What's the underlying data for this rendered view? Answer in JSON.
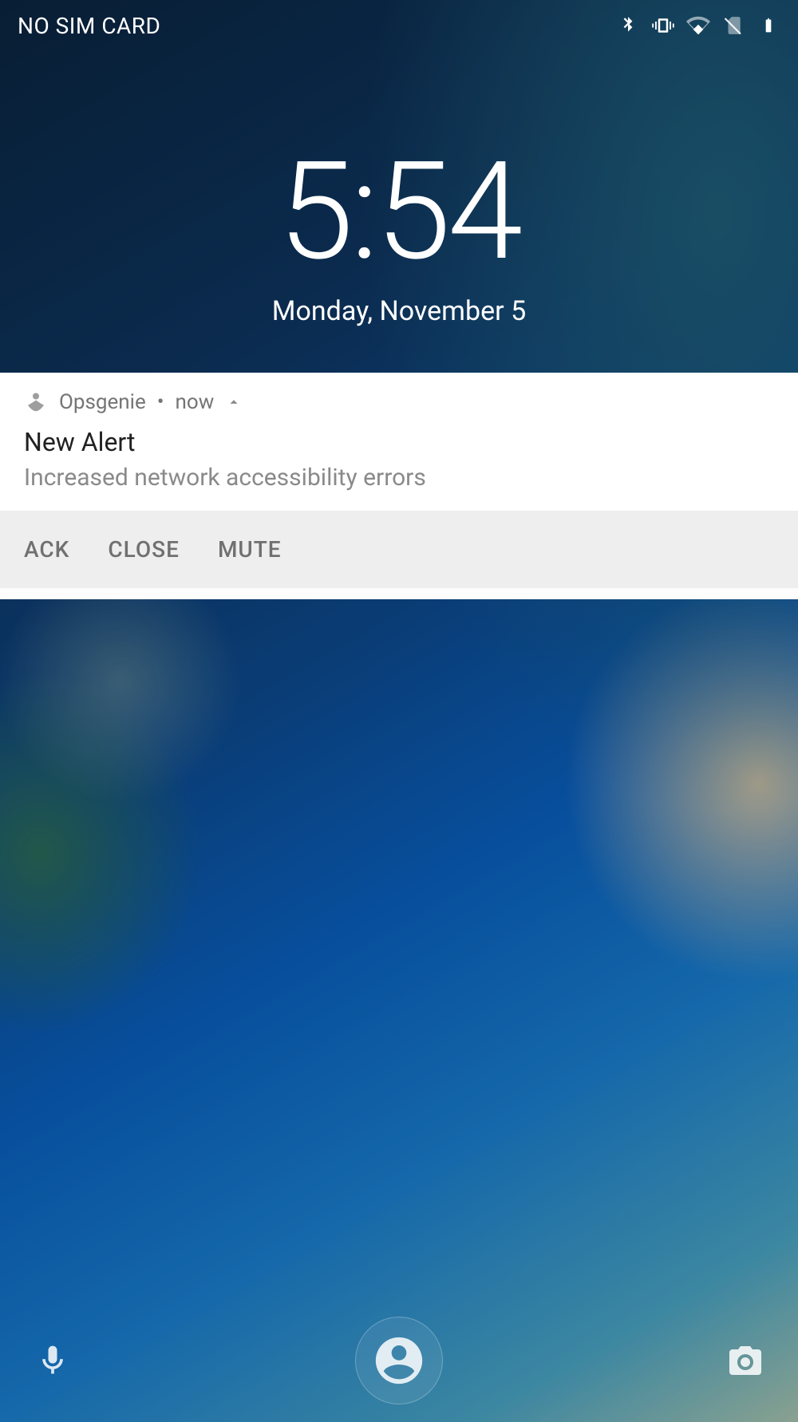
{
  "status_bar": {
    "carrier_text": "NO SIM CARD",
    "icons": [
      "bluetooth",
      "vibrate",
      "wifi-limited",
      "no-sim",
      "battery-full"
    ]
  },
  "clock": {
    "time": "5:54",
    "date": "Monday, November 5"
  },
  "notification": {
    "app_name": "Opsgenie",
    "separator": "•",
    "timestamp": "now",
    "title": "New Alert",
    "body": "Increased network accessibility errors",
    "actions": {
      "ack": "ACK",
      "close": "CLOSE",
      "mute": "MUTE"
    }
  },
  "bottom": {
    "left_icon": "mic",
    "center_icon": "user",
    "right_icon": "camera"
  }
}
